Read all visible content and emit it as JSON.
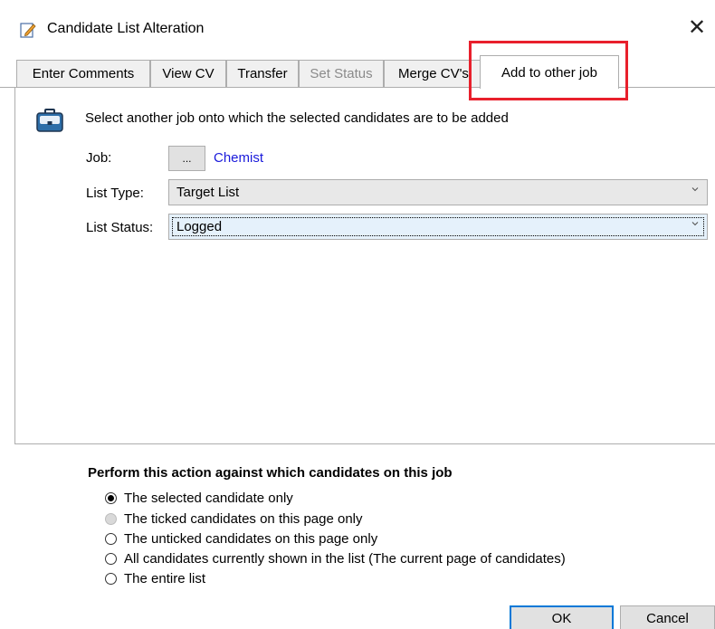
{
  "window": {
    "title": "Candidate List Alteration",
    "close_glyph": "✕"
  },
  "tabs": [
    {
      "label": "Enter Comments"
    },
    {
      "label": "View CV"
    },
    {
      "label": "Transfer"
    },
    {
      "label": "Set Status",
      "disabled": true
    },
    {
      "label": "Merge CV's"
    },
    {
      "label": "Add to other job",
      "active": true
    }
  ],
  "panel": {
    "instructions": "Select another job onto which the selected candidates are to be added",
    "job": {
      "label": "Job:",
      "browse_label": "...",
      "value": "Chemist"
    },
    "list_type": {
      "label": "List Type:",
      "value": "Target List"
    },
    "list_status": {
      "label": "List Status:",
      "value": "Logged"
    }
  },
  "candidates_group": {
    "title": "Perform this action against which candidates on this job",
    "options": [
      {
        "label": "The selected candidate only",
        "checked": true
      },
      {
        "label": "The ticked candidates on this page only",
        "disabled": true
      },
      {
        "label": "The unticked candidates on this page only"
      },
      {
        "label": "All candidates currently shown in the list (The current page of candidates)"
      },
      {
        "label": "The entire list"
      }
    ]
  },
  "buttons": {
    "ok": "OK",
    "cancel": "Cancel"
  },
  "colors": {
    "highlight": "#e8202c",
    "link": "#1a1adb",
    "focus": "#0078d7"
  },
  "icons": {
    "title": "edit-pencil-icon",
    "section": "briefcase-icon",
    "dropdown": "chevron-down-icon"
  }
}
